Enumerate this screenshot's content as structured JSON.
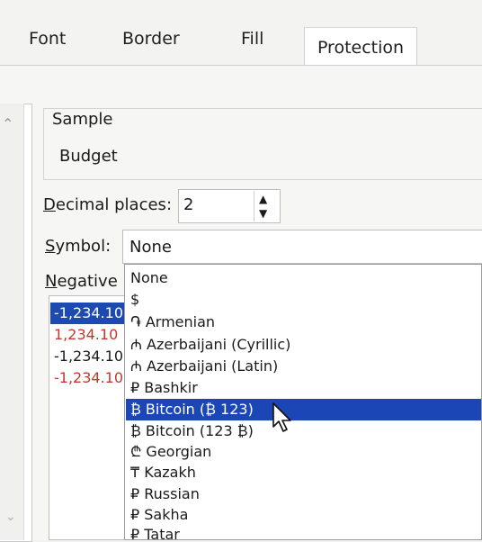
{
  "tabs": [
    "Font",
    "Border",
    "Fill",
    "Protection"
  ],
  "sample": {
    "label": "Sample",
    "value": "Budget"
  },
  "decimal": {
    "label_u": "D",
    "label_rest": "ecimal places:",
    "value": "2"
  },
  "symbol": {
    "label_u": "S",
    "label_rest": "ymbol:",
    "value": "None"
  },
  "negative": {
    "label_u": "N",
    "label_rest": "egative n",
    "items": [
      "-1,234.10",
      "1,234.10",
      "-1,234.10",
      "-1,234.10"
    ],
    "colors": [
      "#ffffff",
      "#c0392b",
      "#1a1a1a",
      "#c0392b"
    ]
  },
  "dropdown": {
    "items": [
      "None",
      "$",
      "֏ Armenian",
      "₼ Azerbaijani (Cyrillic)",
      "₼ Azerbaijani (Latin)",
      "₽ Bashkir",
      "₿ Bitcoin (₿ 123)",
      "₿ Bitcoin (123 ₿)",
      "₾ Georgian",
      "₸ Kazakh",
      "₽ Russian",
      "₽ Sakha",
      "₽ Tatar"
    ],
    "selected_index": 6,
    "highlight_color": "#1b46b6"
  }
}
